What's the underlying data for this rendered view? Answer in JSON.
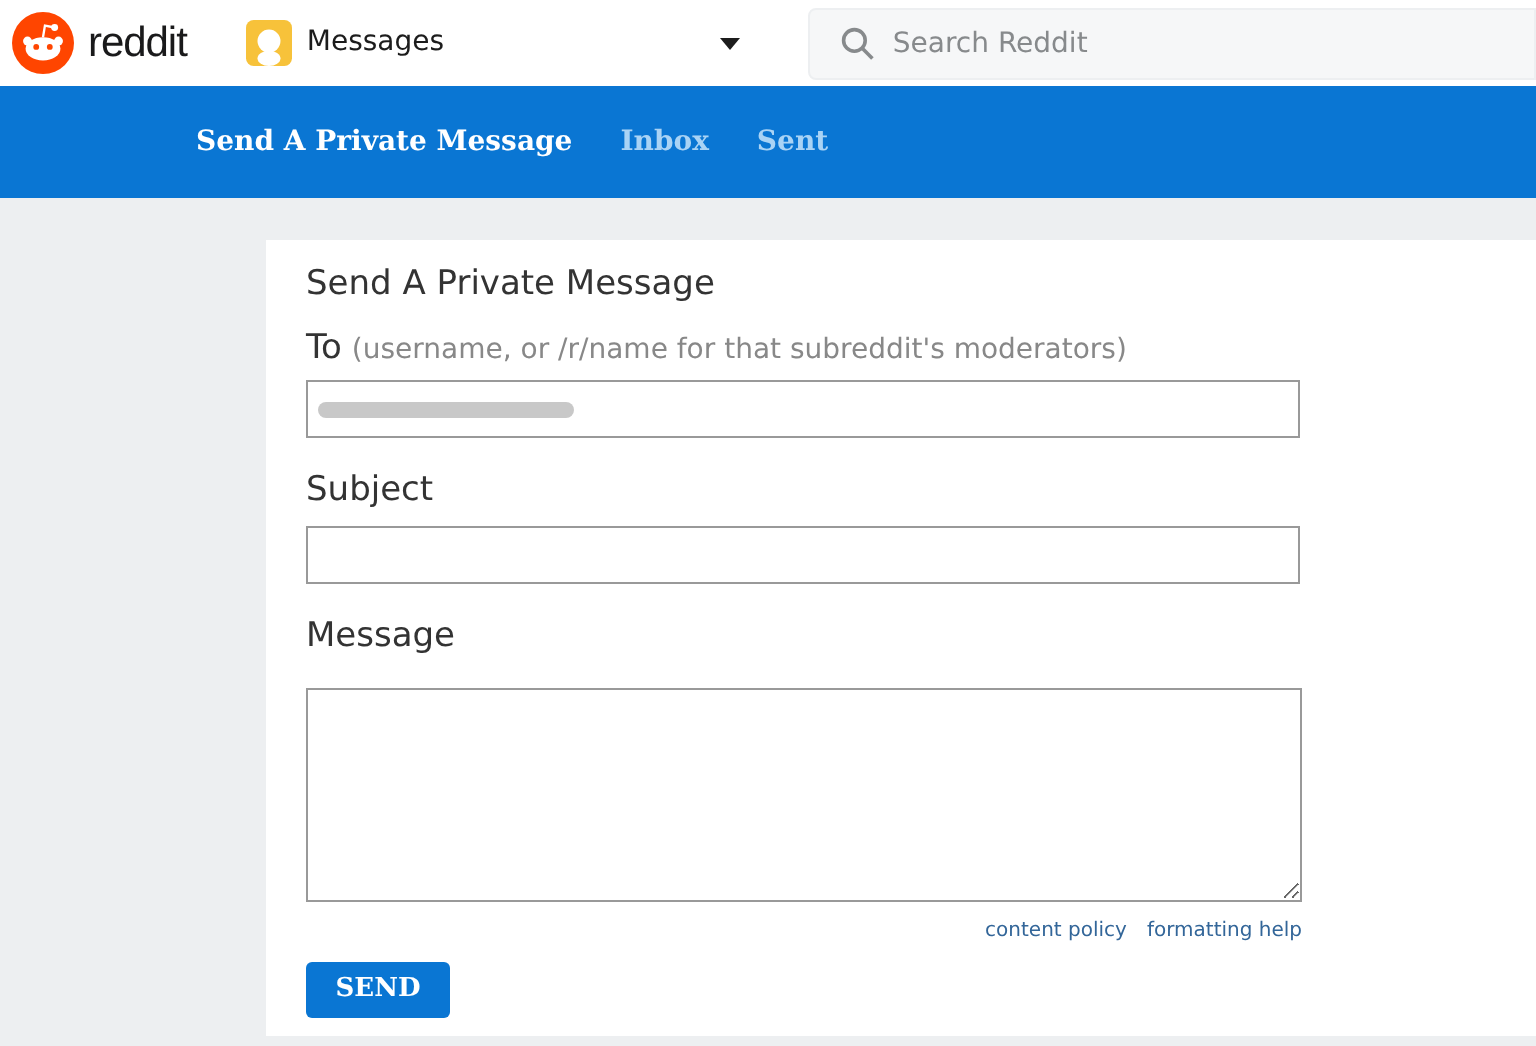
{
  "header": {
    "logo_text": "reddit",
    "community": "Messages",
    "search": {
      "placeholder": "Search Reddit"
    }
  },
  "tabs": [
    {
      "label": "Send A Private Message",
      "selected": true
    },
    {
      "label": "Inbox",
      "selected": false
    },
    {
      "label": "Sent",
      "selected": false
    }
  ],
  "form": {
    "title": "Send A Private Message",
    "to": {
      "label": "To",
      "hint": "(username, or /r/name for that subreddit's moderators)",
      "redacted": true
    },
    "subject": {
      "label": "Subject"
    },
    "message": {
      "label": "Message"
    },
    "links": [
      "content policy",
      "formatting help"
    ],
    "submit": "SEND"
  }
}
